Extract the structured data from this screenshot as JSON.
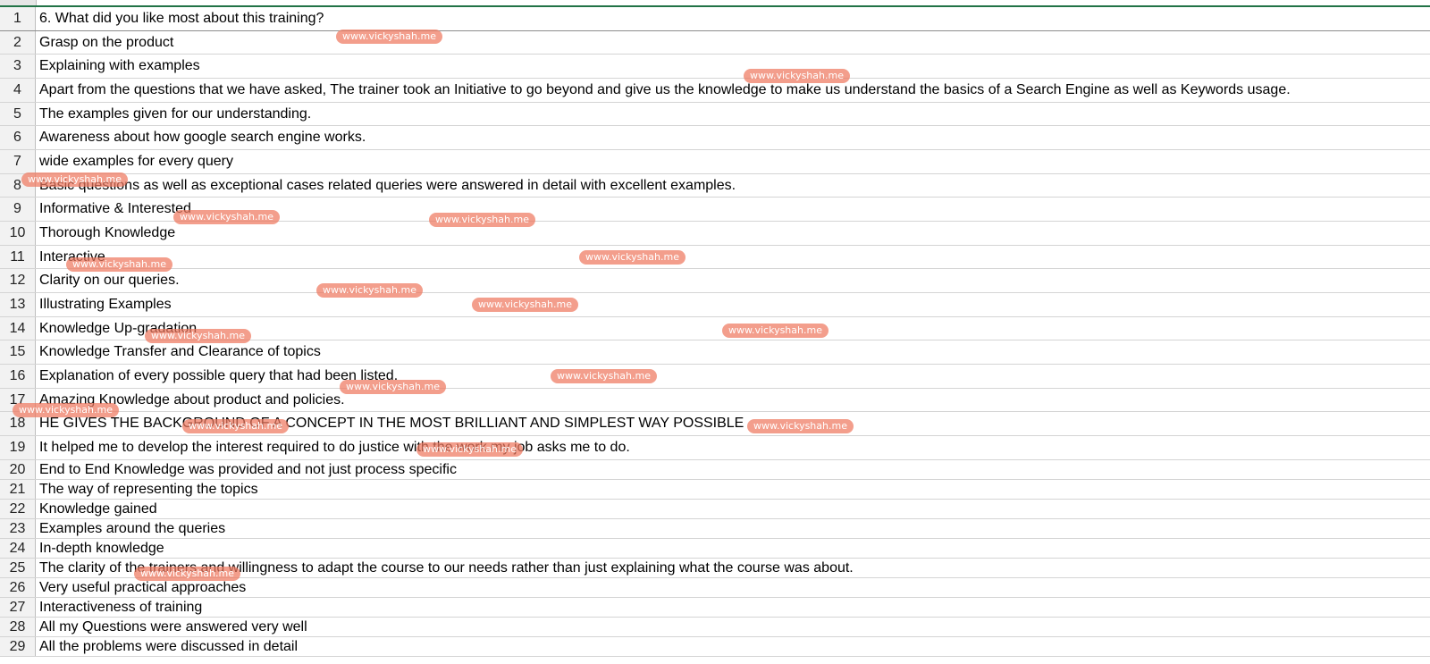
{
  "spreadsheet": {
    "rows": [
      {
        "num": "1",
        "text": "6. What did you like most about this training?"
      },
      {
        "num": "2",
        "text": "Grasp on the product"
      },
      {
        "num": "3",
        "text": "Explaining with examples"
      },
      {
        "num": "4",
        "text": "Apart from the questions that we have asked, The trainer took an Initiative to go beyond and give us the knowledge to make us understand the basics of a Search Engine as well as Keywords usage."
      },
      {
        "num": "5",
        "text": "The examples given for our understanding."
      },
      {
        "num": "6",
        "text": "Awareness about how google search engine works."
      },
      {
        "num": "7",
        "text": "wide examples for every query"
      },
      {
        "num": "8",
        "text": "Basic questions as well as exceptional cases related queries were answered in detail with excellent examples."
      },
      {
        "num": "9",
        "text": "Informative & Interested"
      },
      {
        "num": "10",
        "text": "Thorough Knowledge"
      },
      {
        "num": "11",
        "text": "Interactive"
      },
      {
        "num": "12",
        "text": "Clarity on our queries."
      },
      {
        "num": "13",
        "text": "Illustrating Examples"
      },
      {
        "num": "14",
        "text": "Knowledge Up-gradation"
      },
      {
        "num": "15",
        "text": "Knowledge Transfer and Clearance of topics"
      },
      {
        "num": "16",
        "text": "Explanation of every possible query that had been listed."
      },
      {
        "num": "17",
        "text": "Amazing Knowledge about product and policies."
      },
      {
        "num": "18",
        "text": "HE GIVES THE BACKGROUND OF A CONCEPT IN THE MOST BRILLIANT AND SIMPLEST WAY POSSIBLE"
      },
      {
        "num": "19",
        "text": "It helped me to develop the interest required to do justice with the work my job asks me to do."
      },
      {
        "num": "20",
        "text": "End to End Knowledge was provided and not just process specific"
      },
      {
        "num": "21",
        "text": "The way of representing the topics"
      },
      {
        "num": "22",
        "text": "Knowledge gained"
      },
      {
        "num": "23",
        "text": "Examples around the queries"
      },
      {
        "num": "24",
        "text": "In-depth knowledge"
      },
      {
        "num": "25",
        "text": "The clarity of the trainers and willingness to adapt the course to our needs rather than just explaining what the course was about."
      },
      {
        "num": "26",
        "text": "Very useful practical approaches"
      },
      {
        "num": "27",
        "text": "Interactiveness of training"
      },
      {
        "num": "28",
        "text": "All my Questions were answered very well"
      },
      {
        "num": "29",
        "text": "All the problems were discussed in detail"
      }
    ]
  },
  "watermark": {
    "text": "www.vickyshah.me",
    "color": "#ee7860"
  }
}
